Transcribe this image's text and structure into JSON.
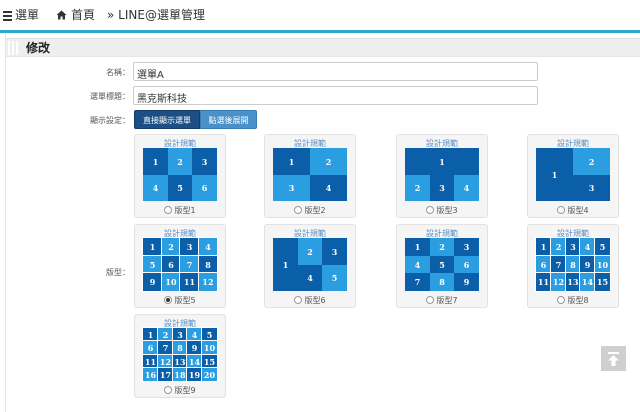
{
  "header": {
    "menu_label": "選單",
    "home_label": "首頁",
    "breadcrumb_label": "» LINE@選單管理"
  },
  "section": {
    "title": "修改"
  },
  "form": {
    "name_label": "名稱：",
    "name_value": "選單A",
    "menu_title_label": "選單標題：",
    "menu_title_value": "黑克斯科技",
    "display_label": "顯示設定：",
    "display_options": [
      "直接顯示選單",
      "點選後展開"
    ],
    "display_selected": "直接顯示選單",
    "layout_label": "版型："
  },
  "layouts": [
    {
      "caption": "設計規範",
      "name": "版型1",
      "cells": [
        "1",
        "2",
        "3",
        "4",
        "5",
        "6"
      ],
      "selected": false
    },
    {
      "caption": "設計規範",
      "name": "版型2",
      "cells": [
        "1",
        "2",
        "3",
        "4"
      ],
      "selected": false
    },
    {
      "caption": "設計規範",
      "name": "版型3",
      "cells": [
        "1",
        "2",
        "3",
        "4"
      ],
      "selected": false
    },
    {
      "caption": "設計規範",
      "name": "版型4",
      "cells": [
        "1",
        "2",
        "3"
      ],
      "selected": false
    },
    {
      "caption": "設計規範",
      "name": "版型5",
      "cells": [
        "1",
        "2",
        "3",
        "4",
        "5",
        "6",
        "7",
        "8",
        "9",
        "10",
        "11",
        "12"
      ],
      "selected": true
    },
    {
      "caption": "設計規範",
      "name": "版型6",
      "cells": [
        "1",
        "2",
        "3",
        "4",
        "5"
      ],
      "selected": false
    },
    {
      "caption": "設計規範",
      "name": "版型7",
      "cells": [
        "1",
        "2",
        "3",
        "4",
        "5",
        "6",
        "7",
        "8",
        "9"
      ],
      "selected": false
    },
    {
      "caption": "設計規範",
      "name": "版型8",
      "cells": [
        "1",
        "2",
        "3",
        "4",
        "5",
        "6",
        "7",
        "8",
        "9",
        "10",
        "11",
        "12",
        "13",
        "14",
        "15"
      ],
      "selected": false
    },
    {
      "caption": "設計規範",
      "name": "版型9",
      "cells": [
        "1",
        "2",
        "3",
        "4",
        "5",
        "6",
        "7",
        "8",
        "9",
        "10",
        "11",
        "12",
        "13",
        "14",
        "15",
        "16",
        "17",
        "18",
        "19",
        "20"
      ],
      "selected": false
    }
  ],
  "icons": {
    "menu": "hamburger-icon",
    "home": "home-icon",
    "back_to_top": "arrow-up-icon"
  },
  "colors": {
    "accent": "#2fa8d8",
    "cell_dark": "#0b5ea8",
    "cell_light": "#2a9ee1",
    "btn_active": "#1b4f86",
    "btn_inactive": "#4a90c9"
  }
}
